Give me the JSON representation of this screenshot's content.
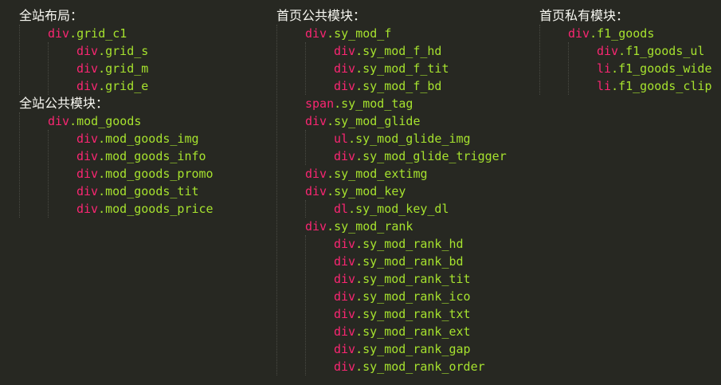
{
  "columns": [
    {
      "sections": [
        {
          "heading": "全站布局：",
          "items": [
            {
              "tag": "div",
              "cls": ".grid_c1",
              "level": 1
            },
            {
              "tag": "div",
              "cls": ".grid_s",
              "level": 2
            },
            {
              "tag": "div",
              "cls": ".grid_m",
              "level": 2
            },
            {
              "tag": "div",
              "cls": ".grid_e",
              "level": 2
            }
          ]
        },
        {
          "heading": "全站公共模块：",
          "items": [
            {
              "tag": "div",
              "cls": ".mod_goods",
              "level": 1
            },
            {
              "tag": "div",
              "cls": ".mod_goods_img",
              "level": 2
            },
            {
              "tag": "div",
              "cls": ".mod_goods_info",
              "level": 2
            },
            {
              "tag": "div",
              "cls": ".mod_goods_promo",
              "level": 2
            },
            {
              "tag": "div",
              "cls": ".mod_goods_tit",
              "level": 2
            },
            {
              "tag": "div",
              "cls": ".mod_goods_price",
              "level": 2
            }
          ]
        }
      ]
    },
    {
      "sections": [
        {
          "heading": "首页公共模块：",
          "items": [
            {
              "tag": "div",
              "cls": ".sy_mod_f",
              "level": 1
            },
            {
              "tag": "div",
              "cls": ".sy_mod_f_hd",
              "level": 2
            },
            {
              "tag": "div",
              "cls": ".sy_mod_f_tit",
              "level": 2
            },
            {
              "tag": "div",
              "cls": ".sy_mod_f_bd",
              "level": 2
            },
            {
              "tag": "span",
              "cls": ".sy_mod_tag",
              "level": 1
            },
            {
              "tag": "div",
              "cls": ".sy_mod_glide",
              "level": 1
            },
            {
              "tag": "ul",
              "cls": ".sy_mod_glide_img",
              "level": 2
            },
            {
              "tag": "div",
              "cls": ".sy_mod_glide_trigger",
              "level": 2
            },
            {
              "tag": "div",
              "cls": ".sy_mod_extimg",
              "level": 1
            },
            {
              "tag": "div",
              "cls": ".sy_mod_key",
              "level": 1
            },
            {
              "tag": "dl",
              "cls": ".sy_mod_key_dl",
              "level": 2
            },
            {
              "tag": "div",
              "cls": ".sy_mod_rank",
              "level": 1
            },
            {
              "tag": "div",
              "cls": ".sy_mod_rank_hd",
              "level": 2
            },
            {
              "tag": "div",
              "cls": ".sy_mod_rank_bd",
              "level": 2
            },
            {
              "tag": "div",
              "cls": ".sy_mod_rank_tit",
              "level": 2
            },
            {
              "tag": "div",
              "cls": ".sy_mod_rank_ico",
              "level": 2
            },
            {
              "tag": "div",
              "cls": ".sy_mod_rank_txt",
              "level": 2
            },
            {
              "tag": "div",
              "cls": ".sy_mod_rank_ext",
              "level": 2
            },
            {
              "tag": "div",
              "cls": ".sy_mod_rank_gap",
              "level": 2
            },
            {
              "tag": "div",
              "cls": ".sy_mod_rank_order",
              "level": 2
            }
          ]
        }
      ]
    },
    {
      "sections": [
        {
          "heading": "首页私有模块：",
          "items": [
            {
              "tag": "div",
              "cls": ".f1_goods",
              "level": 1
            },
            {
              "tag": "div",
              "cls": ".f1_goods_ul",
              "level": 2
            },
            {
              "tag": "li",
              "cls": ".f1_goods_wide",
              "level": 2
            },
            {
              "tag": "li",
              "cls": ".f1_goods_clip",
              "level": 2
            }
          ]
        }
      ]
    }
  ],
  "colors": {
    "background": "#272822",
    "heading": "#f8f8f2",
    "tag": "#f92672",
    "class_name": "#a6e22e",
    "indent_guide": "#4a4b44"
  }
}
